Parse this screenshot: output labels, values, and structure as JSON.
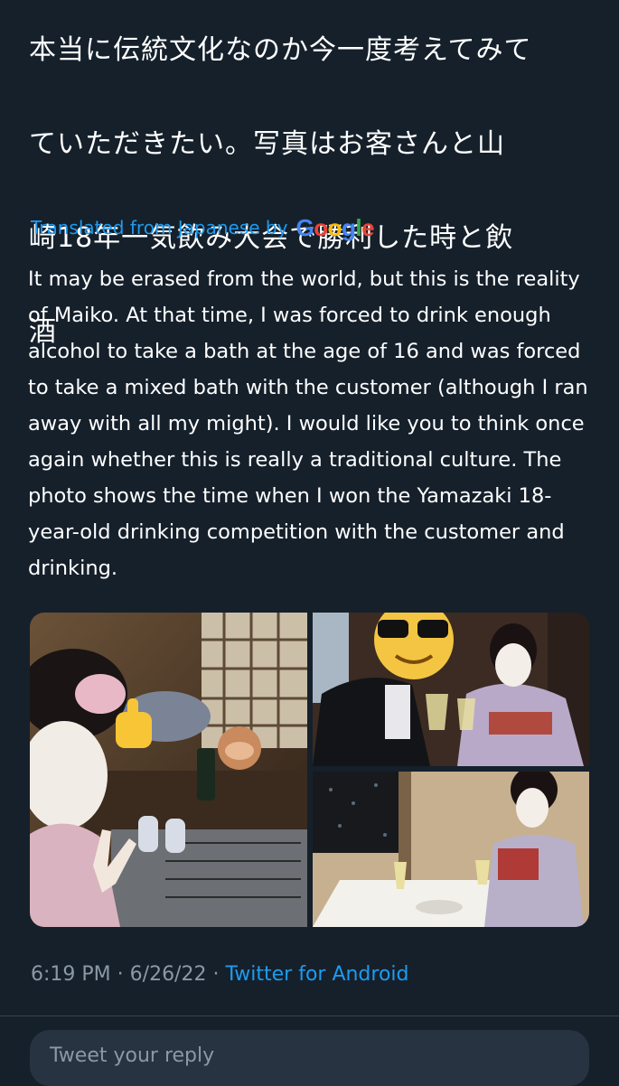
{
  "tweet": {
    "original_text_lines": [
      "本当に伝統文化なのか今一度考えてみて",
      "ていただきたい。写真はお客さんと山",
      "崎18年一気飲み大会で勝利した時と飲",
      "酒"
    ],
    "translation_label": "Translated from Japanese by",
    "translation_provider_letters": [
      {
        "char": "G",
        "color": "#4285f4"
      },
      {
        "char": "o",
        "color": "#ea4335"
      },
      {
        "char": "o",
        "color": "#fbbc05"
      },
      {
        "char": "g",
        "color": "#4285f4"
      },
      {
        "char": "l",
        "color": "#34a853"
      },
      {
        "char": "e",
        "color": "#ea4335"
      }
    ],
    "translated_text": "It may be erased from the world, but this is the reality of Maiko. At that time, I was forced to drink enough alcohol to take a bath at the age of 16 and was forced to take a mixed bath with the customer (although I ran away with all my might). I would like you to think once again whether this is really a traditional culture. The photo shows the time when I won the Yamazaki 18-year-old drinking competition with the customer and drinking.",
    "timestamp": "6:19 PM",
    "date": "6/26/22",
    "separator": "·",
    "source": "Twitter for Android"
  },
  "reply": {
    "placeholder": "Tweet your reply"
  },
  "media": {
    "photos": [
      {
        "name": "photo-maiko-selfie-bar",
        "emojis": [
          "thumbs-up-icon",
          "see-no-evil-monkey-icon"
        ]
      },
      {
        "name": "photo-toast-with-customer",
        "emojis": [
          "sunglasses-face-icon"
        ]
      },
      {
        "name": "photo-maiko-at-dinner",
        "emojis": []
      }
    ]
  },
  "colors": {
    "background": "#15202b",
    "link": "#1d9bf0",
    "muted": "#8b98a5",
    "input_bg": "#273340"
  }
}
